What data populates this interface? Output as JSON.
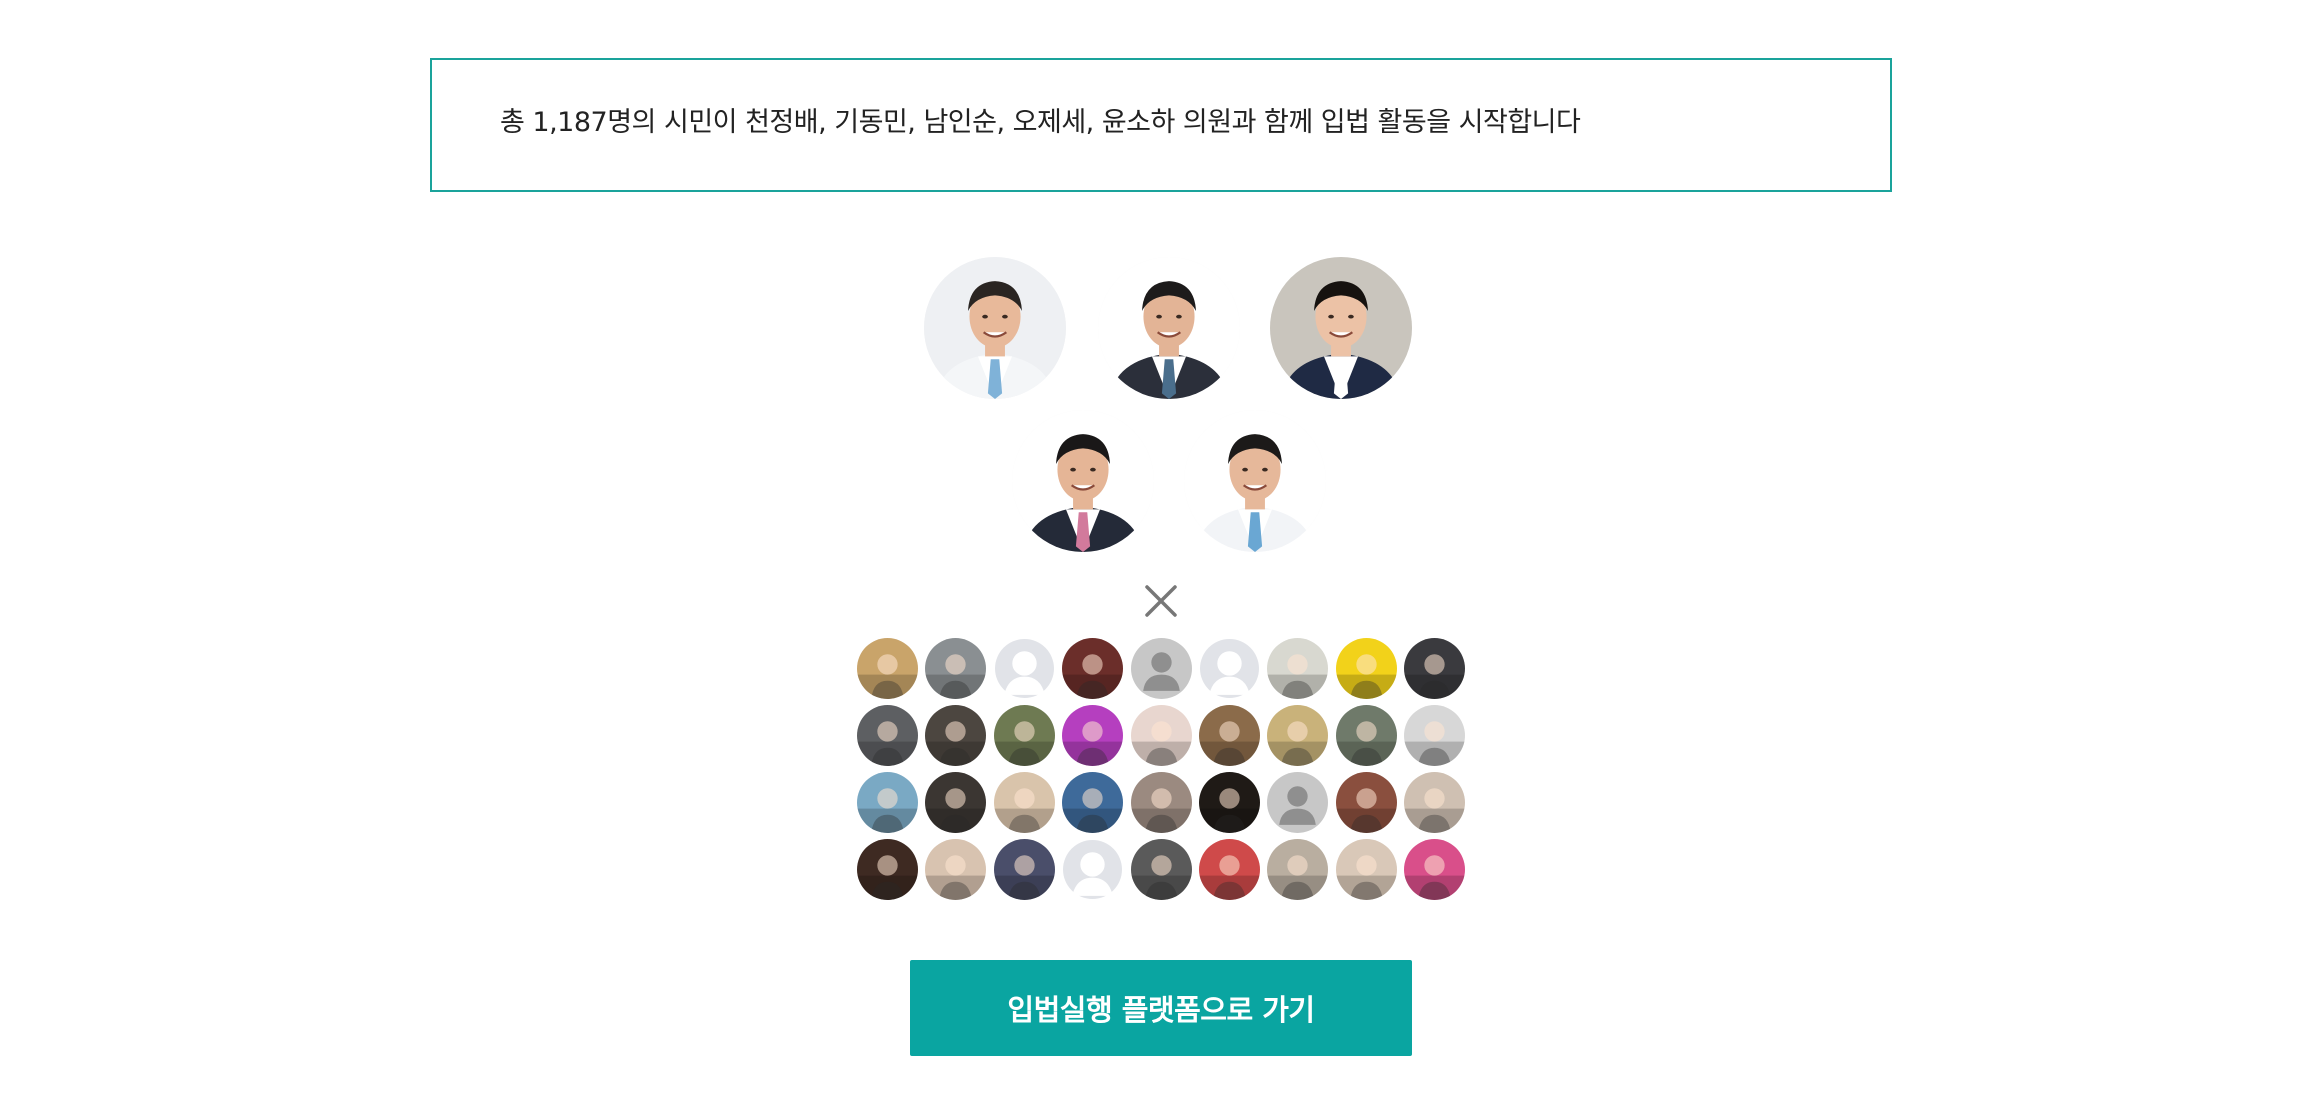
{
  "summary": {
    "text": "총 1,187명의 시민이 천정배, 기동민, 남인순, 오제세, 윤소하 의원과 함께 입법 활동을 시작합니다"
  },
  "accent_color": "#0aa5a1",
  "legislators": [
    {
      "id": "legislator-1",
      "bg": "#eef0f3",
      "suit": "#f4f6f8",
      "tie": "#7fb2d8",
      "hair": "#2a2522",
      "skin": "#e8b99a"
    },
    {
      "id": "legislator-2",
      "bg": "#ffffff",
      "suit": "#2b2f3a",
      "tie": "#4a6e8c",
      "hair": "#1d1b1b",
      "skin": "#e3b496"
    },
    {
      "id": "legislator-3",
      "bg": "#c9c5bd",
      "suit": "#1f2a44",
      "tie": "#ffffff",
      "hair": "#16120f",
      "skin": "#ecc2a6"
    },
    {
      "id": "legislator-4",
      "bg": "#ffffff",
      "suit": "#242a38",
      "tie": "#d27a9c",
      "hair": "#1a1818",
      "skin": "#e5b596"
    },
    {
      "id": "legislator-5",
      "bg": "#ffffff",
      "suit": "#f2f4f7",
      "tie": "#6aa7d3",
      "hair": "#1c1a19",
      "skin": "#e6b89a"
    }
  ],
  "times_icon": "times-icon",
  "citizens": [
    "#c9a46a",
    "#8a8f92",
    "#dfe1e5",
    "#6b2e2a",
    "#b5b5b5",
    "#e3e3e6",
    "#d8d8d0",
    "#f2d21a",
    "#3a3a3e",
    "#5d5f62",
    "#4c4640",
    "#6e7a52",
    "#b53fbf",
    "#e8d6cf",
    "#8b6b4a",
    "#c9b27a",
    "#6f7a6a",
    "#d7d7d7",
    "#7aa9c4",
    "#3b3632",
    "#d9c4ab",
    "#3e6a9a",
    "#9b8a80",
    "#1f1a16",
    "#b7b7b7",
    "#8a4f3e",
    "#cfc0b2",
    "#3e2a22",
    "#d8c3b0",
    "#4a4e6a",
    "#dfe1e5",
    "#5a5a5a",
    "#cf4a4a",
    "#b9aea0",
    "#d9c8b8",
    "#d94f8a"
  ],
  "citizen_placeholders": [
    2,
    5,
    30
  ],
  "citizen_person_icons": [
    4,
    24
  ],
  "cta": {
    "label": "입법실행 플랫폼으로 가기"
  }
}
